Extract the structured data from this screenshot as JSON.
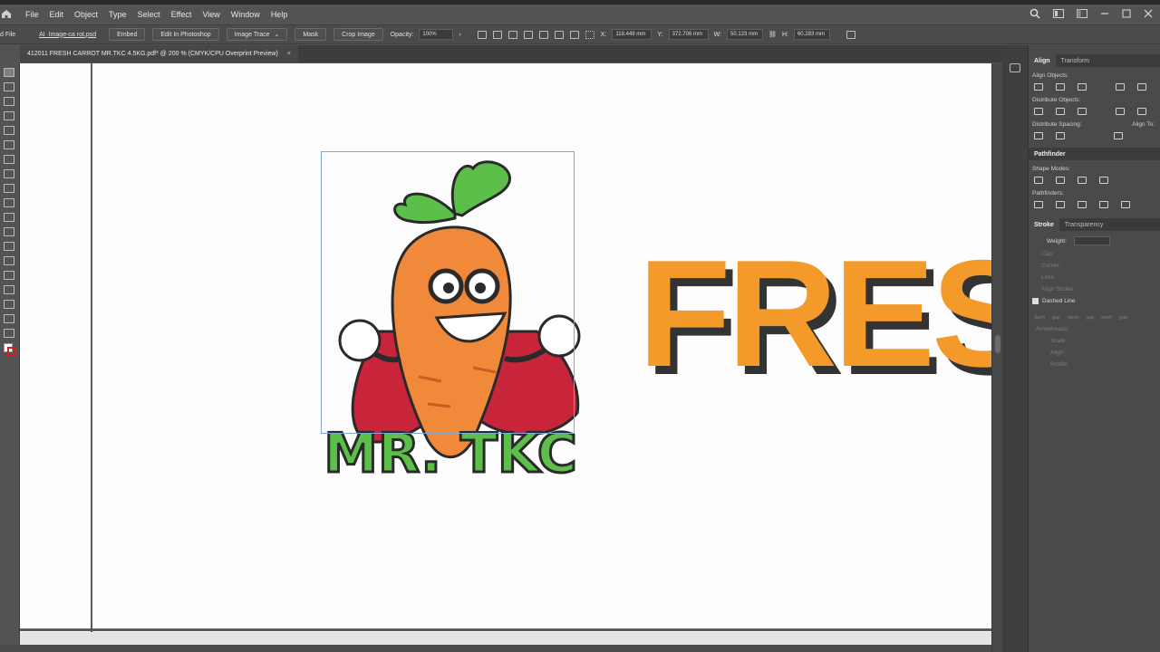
{
  "menubar": {
    "items": [
      "File",
      "Edit",
      "Object",
      "Type",
      "Select",
      "Effect",
      "View",
      "Window",
      "Help"
    ]
  },
  "controlbar": {
    "left_label": "d File",
    "filename": "AI_Image-ca rot.psd",
    "embed": "Embed",
    "edit_photoshop": "Edit In Photoshop",
    "image_trace": "Image Trace",
    "mask": "Mask",
    "crop": "Crop Image",
    "opacity_label": "Opacity:",
    "opacity_value": "100%",
    "x_label": "X:",
    "x_value": "118.449 mm",
    "y_label": "Y:",
    "y_value": "372.706 mm",
    "w_label": "W:",
    "w_value": "50.123 mm",
    "h_label": "H:",
    "h_value": "60.283 mm"
  },
  "document_tab": {
    "title": "412011 FRESH CARROT MR.TKC 4.5KG.pdf* @ 200 % (CMYK/CPU Overprint Preview)",
    "close": "×"
  },
  "artwork": {
    "logo_text": "MR. TKC",
    "headline": "FRESH"
  },
  "panel": {
    "tab_align": "Align",
    "tab_transform": "Transform",
    "align_objects": "Align Objects:",
    "distribute_objects": "Distribute Objects:",
    "distribute_spacing": "Distribute Spacing:",
    "align_to": "Align To:",
    "pathfinder": "Pathfinder",
    "shape_modes": "Shape Modes:",
    "pathfinders": "Pathfinders:",
    "tab_stroke": "Stroke",
    "tab_transparency": "Transparency",
    "weight": "Weight:",
    "cap": "Cap:",
    "corner": "Corner:",
    "limit": "Limit:",
    "align_stroke": "Align Stroke:",
    "dashed_line": "Dashed Line",
    "dash_labels": [
      "dash",
      "gap",
      "dash",
      "gap",
      "dash",
      "gap"
    ],
    "arrowheads": "Arrowheads:",
    "scale": "Scale:",
    "align": "Align:",
    "profile": "Profile:"
  },
  "colors": {
    "accent_orange": "#f39a2b",
    "ui_dark": "#535353",
    "carrot": "#f08a3a",
    "leaf": "#5cbf4a",
    "cape": "#c8243a"
  }
}
